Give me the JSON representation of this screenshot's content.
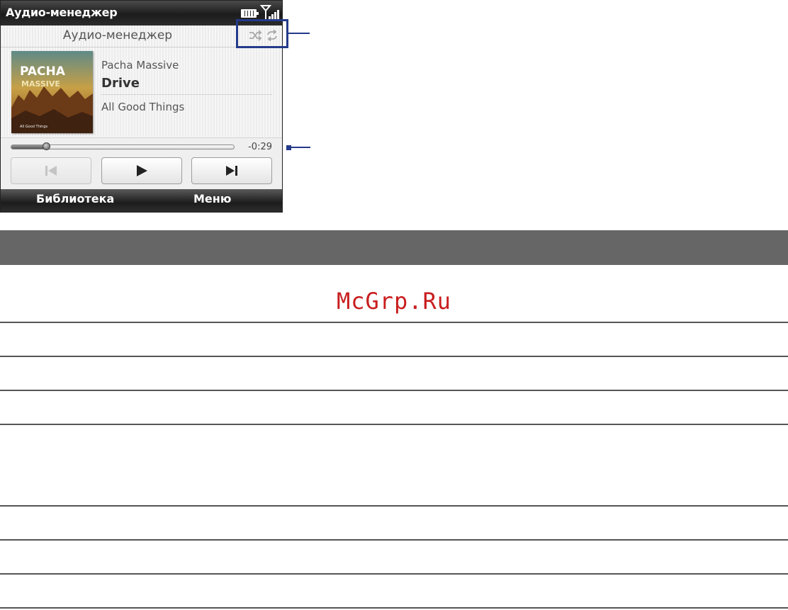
{
  "status_bar": {
    "title": "Аудио-менеджер"
  },
  "header": {
    "title": "Аудио-менеджер"
  },
  "now_playing": {
    "artist": "Pacha Massive",
    "song": "Drive",
    "album": "All Good Things",
    "cover_text_top": "PACHA",
    "cover_text_mid": "MASSIVE",
    "cover_text_bottom": "All Good Things"
  },
  "playback": {
    "remaining": "-0:29",
    "progress": 0.16
  },
  "softkeys": {
    "left": "Библиотека",
    "right": "Меню"
  },
  "watermark": "McGrp.Ru",
  "colors": {
    "callout": "#243a8a",
    "watermark": "#c81e1e",
    "section_header": "#666666"
  },
  "icons": [
    "battery-icon",
    "signal-icon",
    "shuffle-icon",
    "repeat-icon",
    "previous-icon",
    "play-icon",
    "next-icon"
  ]
}
